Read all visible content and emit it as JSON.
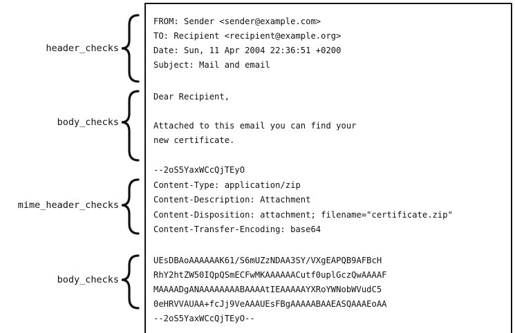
{
  "sections": [
    {
      "label": "header_checks"
    },
    {
      "label": "body_checks"
    },
    {
      "label": "mime_header_checks"
    },
    {
      "label": "body_checks"
    }
  ],
  "message_lines": [
    "FROM: Sender <sender@example.com>",
    "TO: Recipient <recipient@example.org>",
    "Date: Sun, 11 Apr 2004 22:36:51 +0200",
    "Subject: Mail and email",
    "Dear Recipient,",
    "Attached to this email you can find your",
    "new certificate.",
    "--2oS5YaxWCcQjTEyO",
    "Content-Type: application/zip",
    "Content-Description: Attachment",
    "Content-Disposition: attachment; filename=\"certificate.zip\"",
    "Content-Transfer-Encoding: base64",
    "UEsDBAoAAAAAAK61/S6mUZzNDAA3SY/VXgEAPQB9AFBcH",
    "RhY2htZW50IQpQSmECFwMKAAAAAACutf0uplGczQwAAAAF",
    "MAAAADgANAAAAAAAABAAAAtIEAAAAAYXRoYWNobWVudC5",
    "0eHRVVAUAA+fcJj9VeAAAUEsFBgAAAAABAAEASQAAAEoAA",
    "--2oS5YaxWCcQjTEyO--"
  ]
}
